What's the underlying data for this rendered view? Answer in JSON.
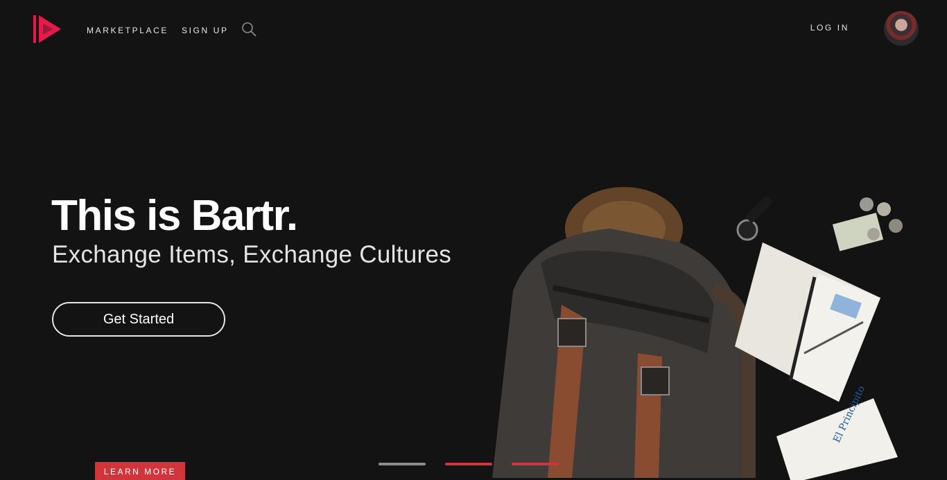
{
  "nav": {
    "links": [
      {
        "label": "MARKETPLACE"
      },
      {
        "label": "SIGN UP"
      }
    ],
    "login_label": "LOG IN",
    "logo_icon": "play-logo-icon",
    "search_icon": "search-icon",
    "accent": "#e6194b"
  },
  "hero": {
    "title": "This is Bartr.",
    "subtitle": "Exchange Items, Exchange Cultures",
    "cta_label": "Get Started",
    "learn_more_label": "LEARN MORE"
  },
  "carousel": {
    "dots": 3,
    "active_index": 0
  },
  "colors": {
    "background": "#141314",
    "accent_red": "#d2343c"
  }
}
